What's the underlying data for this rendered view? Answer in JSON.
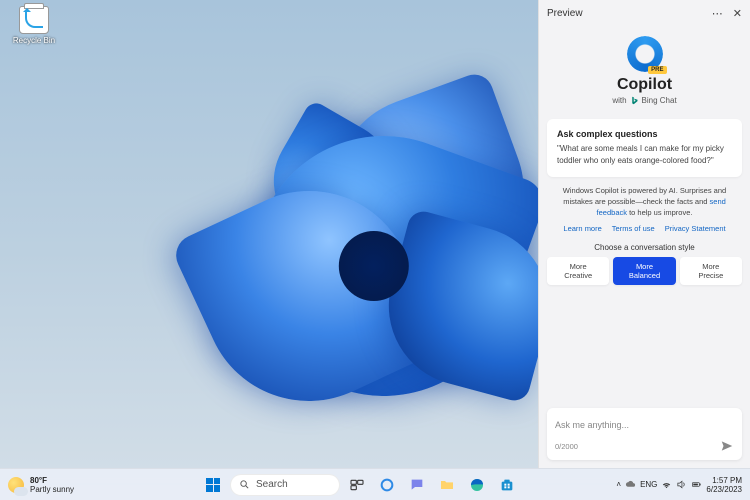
{
  "desktop": {
    "recycle_bin_label": "Recycle Bin"
  },
  "taskbar": {
    "weather": {
      "temp": "80°F",
      "condition": "Partly sunny"
    },
    "search_placeholder": "Search",
    "clock": {
      "time": "1:57 PM",
      "date": "6/23/2023"
    }
  },
  "copilot": {
    "header_label": "Preview",
    "logo_badge": "PRE",
    "title": "Copilot",
    "subtitle_prefix": "with",
    "subtitle_suffix": "Bing Chat",
    "card": {
      "header": "Ask complex questions",
      "example": "\"What are some meals I can make for my picky toddler who only eats orange-colored food?\""
    },
    "info_text_1": "Windows Copilot is powered by AI. Surprises and mistakes are possible—check the facts and ",
    "info_link_feedback": "send feedback",
    "info_text_2": " to help us improve.",
    "links": {
      "learn": "Learn more",
      "terms": "Terms of use",
      "privacy": "Privacy Statement"
    },
    "style_label": "Choose a conversation style",
    "styles": {
      "creative_l1": "More",
      "creative_l2": "Creative",
      "balanced_l1": "More",
      "balanced_l2": "Balanced",
      "precise_l1": "More",
      "precise_l2": "Precise"
    },
    "input_placeholder": "Ask me anything...",
    "char_counter": "0/2000"
  }
}
